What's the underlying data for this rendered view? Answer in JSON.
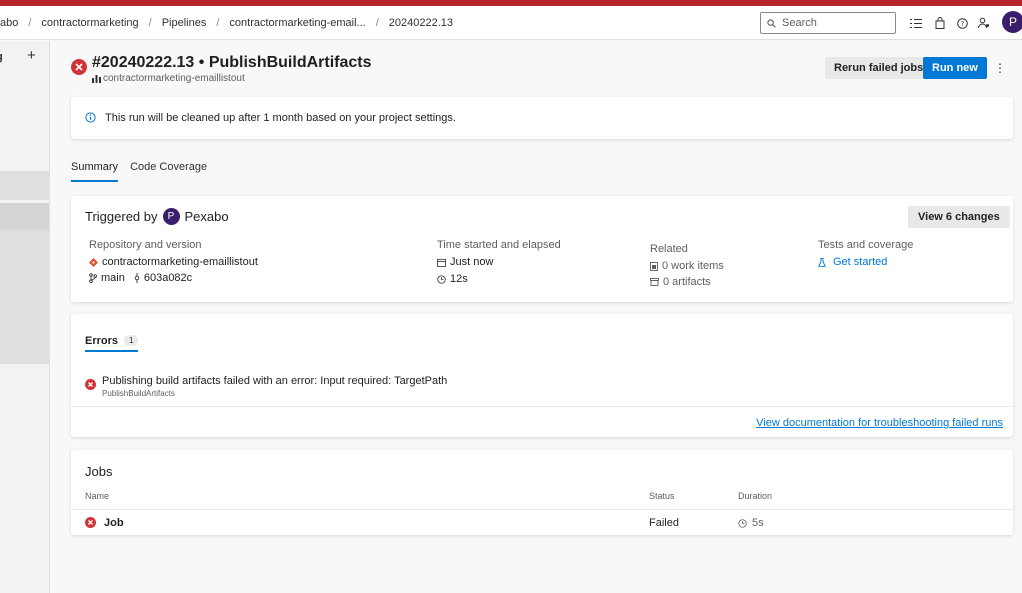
{
  "breadcrumb": {
    "items": [
      "abo",
      "contractormarketing",
      "Pipelines",
      "contractormarketing-email...",
      "20240222.13"
    ],
    "separator": "/"
  },
  "topbar": {
    "search_placeholder": "Search",
    "avatar_initial": "P"
  },
  "sidebar": {
    "label": "g",
    "add_symbol": "+"
  },
  "run": {
    "title": "#20240222.13 • PublishBuildArtifacts",
    "repo_subtitle": "contractormarketing-emaillistout",
    "rerun_label": "Rerun failed jobs",
    "run_new_label": "Run new",
    "more_label": "⋮"
  },
  "info_banner": {
    "text": "This run will be cleaned up after 1 month based on your project settings."
  },
  "tabs": [
    {
      "label": "Summary",
      "active": true
    },
    {
      "label": "Code Coverage",
      "active": false
    }
  ],
  "summary": {
    "triggered_prefix": "Triggered by",
    "triggered_user": "Pexabo",
    "triggered_initial": "P",
    "view_changes_label": "View 6 changes",
    "repository": {
      "header": "Repository and version",
      "repo": "contractormarketing-emaillistout",
      "branch": "main",
      "commit": "603a082c"
    },
    "time": {
      "header": "Time started and elapsed",
      "started": "Just now",
      "elapsed": "12s"
    },
    "related": {
      "header": "Related",
      "work_items": "0 work items",
      "artifacts": "0 artifacts"
    },
    "tests": {
      "header": "Tests and coverage",
      "link": "Get started"
    }
  },
  "errors": {
    "tab_label": "Errors",
    "count": "1",
    "message": "Publishing build artifacts failed with an error: Input required: TargetPath",
    "source": "PublishBuildArtifacts",
    "doc_link": "View documentation for troubleshooting failed runs"
  },
  "jobs": {
    "title": "Jobs",
    "columns": {
      "name": "Name",
      "status": "Status",
      "duration": "Duration"
    },
    "rows": [
      {
        "name": "Job",
        "status": "Failed",
        "duration": "5s"
      }
    ]
  },
  "colors": {
    "accent": "#0078d4",
    "error": "#d13438",
    "top_strip": "#b4262b",
    "avatar": "#3b1e6b"
  }
}
